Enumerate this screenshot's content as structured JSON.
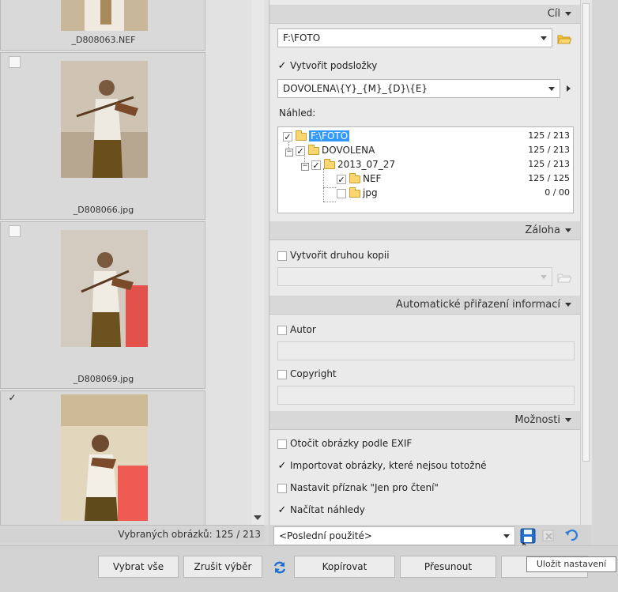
{
  "thumbnails": [
    {
      "filename": "_D808063.NEF",
      "checked": false
    },
    {
      "filename": "_D808066.jpg",
      "checked": false
    },
    {
      "filename": "_D808069.jpg",
      "checked": false
    },
    {
      "filename": "",
      "checked": true
    }
  ],
  "selected_count_label": "Vybraných obrázků: 125 / 213",
  "sections": {
    "target": {
      "header": "Cíl",
      "path_value": "F:\\FOTO",
      "create_subfolders_label": "Vytvořit podsložky",
      "pattern_value": "DOVOLENA\\{Y}_{M}_{D}\\{E}",
      "preview_label": "Náhled:",
      "tree": [
        {
          "name": "F:\\FOTO",
          "count": "125 / 213",
          "checked": true
        },
        {
          "name": "DOVOLENA",
          "count": "125 / 213",
          "checked": true
        },
        {
          "name": "2013_07_27",
          "count": "125 / 213",
          "checked": true
        },
        {
          "name": "NEF",
          "count": "125 / 125",
          "checked": true
        },
        {
          "name": "jpg",
          "count": "0 / 00",
          "checked": false
        }
      ]
    },
    "backup": {
      "header": "Záloha",
      "second_copy_label": "Vytvořit druhou kopii"
    },
    "auto_info": {
      "header": "Automatické přiřazení informací",
      "author_label": "Autor",
      "copyright_label": "Copyright"
    },
    "options": {
      "header": "Možnosti",
      "items": [
        {
          "label": "Otočit obrázky podle EXIF",
          "checked": false
        },
        {
          "label": "Importovat obrázky, které nejsou totožné",
          "checked": true
        },
        {
          "label": "Nastavit příznak \"Jen pro čtení\"",
          "checked": false
        },
        {
          "label": "Načítat náhledy",
          "checked": true
        }
      ]
    }
  },
  "preset_value": "<Poslední použité>",
  "buttons": {
    "select_all": "Vybrat vše",
    "deselect": "Zrušit výběr",
    "copy": "Kopírovat",
    "move": "Přesunout"
  },
  "tooltip": "Uložit nastavení",
  "colors": {
    "folder": "#f8d772",
    "selection": "#3399ff",
    "save_icon": "#1f6fd0"
  }
}
